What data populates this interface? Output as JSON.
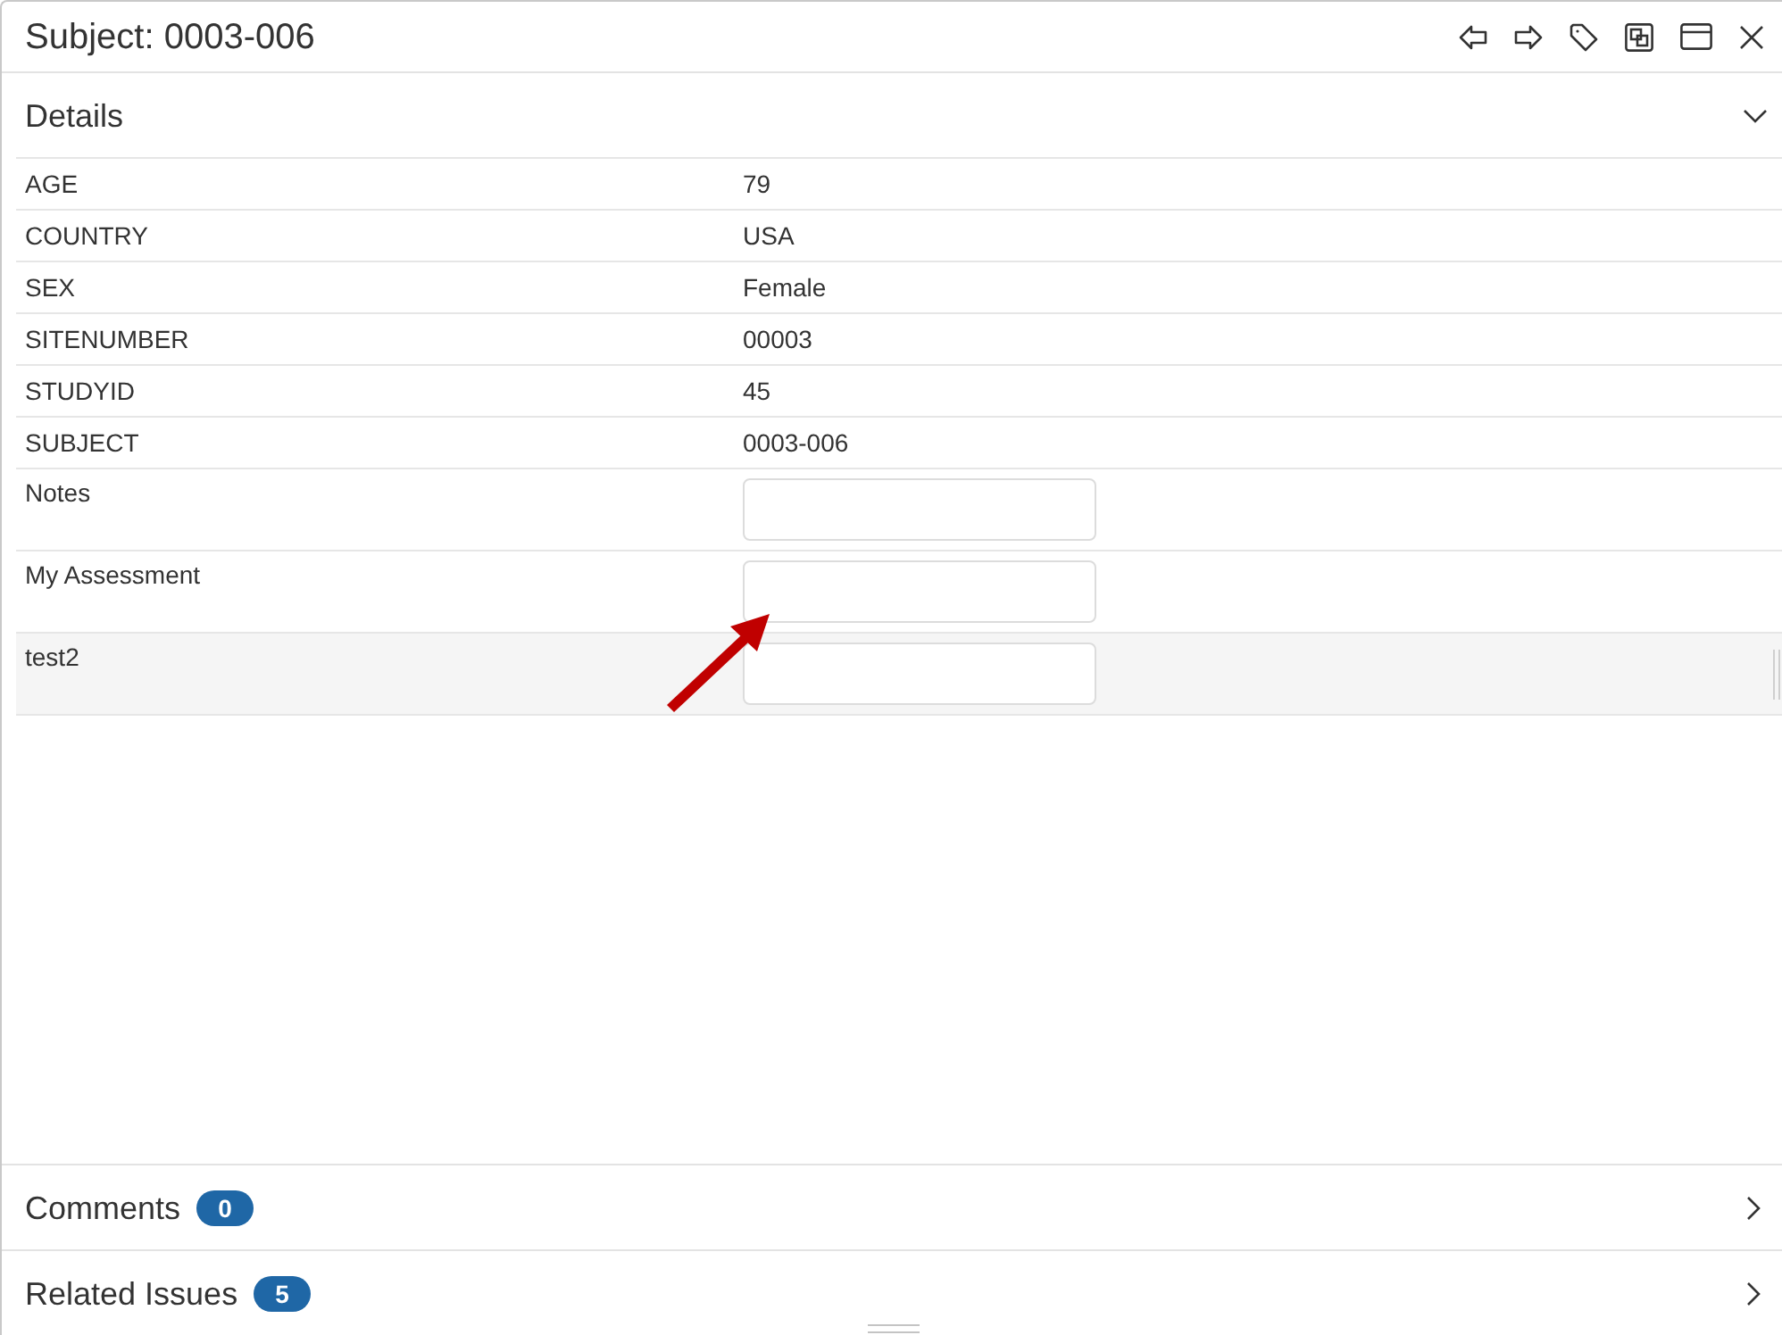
{
  "window": {
    "title": "Subject: 0003-006"
  },
  "details": {
    "title": "Details",
    "expanded": true,
    "fields": [
      {
        "label": "AGE",
        "kind": "text",
        "value": "79",
        "selected": false
      },
      {
        "label": "COUNTRY",
        "kind": "text",
        "value": "USA",
        "selected": false
      },
      {
        "label": "SEX",
        "kind": "text",
        "value": "Female",
        "selected": false
      },
      {
        "label": "SITENUMBER",
        "kind": "text",
        "value": "00003",
        "selected": false
      },
      {
        "label": "STUDYID",
        "kind": "text",
        "value": "45",
        "selected": false
      },
      {
        "label": "SUBJECT",
        "kind": "text",
        "value": "0003-006",
        "selected": false
      },
      {
        "label": "Notes",
        "kind": "input",
        "selected": false
      },
      {
        "label": "My Assessment",
        "kind": "input",
        "selected": false
      },
      {
        "label": "test2",
        "kind": "input",
        "selected": true
      }
    ]
  },
  "sections": [
    {
      "title": "Comments",
      "count": "0",
      "expanded": false
    },
    {
      "title": "Related Issues",
      "count": "5",
      "expanded": false
    }
  ]
}
